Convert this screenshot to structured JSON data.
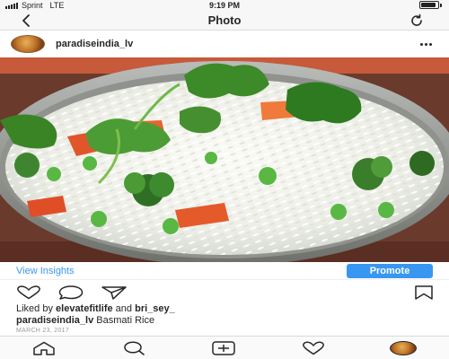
{
  "status_bar": {
    "carrier": "Sprint",
    "network": "LTE",
    "time": "9:19 PM",
    "battery_level": 0.9
  },
  "nav": {
    "title": "Photo",
    "back_icon": "chevron-left-icon",
    "refresh_icon": "refresh-icon"
  },
  "post": {
    "username": "paradiseindia_lv",
    "more_icon": "more-horizontal-icon",
    "photo_subject": "basmati rice with peas, carrots, broccoli and cilantro"
  },
  "insights": {
    "link_label": "View Insights",
    "promote_label": "Promote"
  },
  "likes": {
    "prefix": "Liked by ",
    "user1": "elevatefitlife",
    "conjunction": " and ",
    "user2": "bri_sey_"
  },
  "caption": {
    "username": "paradiseindia_lv",
    "text": " Basmati Rice"
  },
  "date": "MARCH 23, 2017",
  "colors": {
    "accent_blue": "#3897f0",
    "text": "#262626",
    "muted": "#999999"
  },
  "tab_bar": {
    "items": [
      "home-icon",
      "search-icon",
      "add-post-icon",
      "activity-heart-icon",
      "profile-avatar"
    ]
  }
}
